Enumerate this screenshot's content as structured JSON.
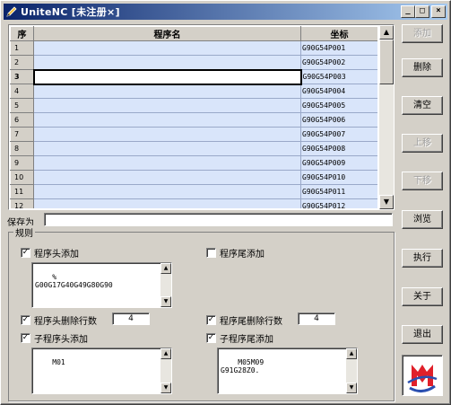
{
  "window": {
    "title": "UniteNC [未注册×]"
  },
  "grid": {
    "headers": {
      "seq": "序",
      "name": "程序名",
      "coord": "坐标"
    },
    "rows": [
      {
        "n": "1",
        "name": "",
        "coord": "G90G54P001"
      },
      {
        "n": "2",
        "name": "",
        "coord": "G90G54P002"
      },
      {
        "n": "3",
        "name": "",
        "coord": "G90G54P003"
      },
      {
        "n": "4",
        "name": "",
        "coord": "G90G54P004"
      },
      {
        "n": "5",
        "name": "",
        "coord": "G90G54P005"
      },
      {
        "n": "6",
        "name": "",
        "coord": "G90G54P006"
      },
      {
        "n": "7",
        "name": "",
        "coord": "G90G54P007"
      },
      {
        "n": "8",
        "name": "",
        "coord": "G90G54P008"
      },
      {
        "n": "9",
        "name": "",
        "coord": "G90G54P009"
      },
      {
        "n": "10",
        "name": "",
        "coord": "G90G54P010"
      },
      {
        "n": "11",
        "name": "",
        "coord": "G90G54P011"
      },
      {
        "n": "12",
        "name": "",
        "coord": "G90G54P012"
      }
    ],
    "active_row": 3
  },
  "buttons": {
    "add": "添加",
    "delete": "删除",
    "clear": "清空",
    "up": "上移",
    "down": "下移",
    "browse": "浏览",
    "execute": "执行",
    "about": "关于",
    "exit": "退出"
  },
  "saveas": {
    "label": "保存为",
    "value": ""
  },
  "rules": {
    "label": "规则",
    "header_add": {
      "label": "程序头添加",
      "checked": true,
      "text": "%\nG00G17G40G49G80G90"
    },
    "tail_add": {
      "label": "程序尾添加",
      "checked": false
    },
    "header_del": {
      "label": "程序头删除行数",
      "checked": true,
      "value": "4"
    },
    "tail_del": {
      "label": "程序尾删除行数",
      "checked": true,
      "value": "4"
    },
    "sub_header_add": {
      "label": "子程序头添加",
      "checked": true,
      "text": "M01"
    },
    "sub_tail_add": {
      "label": "子程序尾添加",
      "checked": true,
      "text": "M05M09\nG91G28Z0."
    }
  },
  "colors": {
    "title_start": "#0a246a",
    "title_end": "#a6caf0",
    "row_bg": "#d9e5fa",
    "face": "#d4d0c8",
    "logo_red": "#e0202a",
    "logo_blue": "#2a4fb0"
  },
  "icons": {
    "app": "pencil-icon",
    "logo": "unitenc-logo-icon"
  }
}
